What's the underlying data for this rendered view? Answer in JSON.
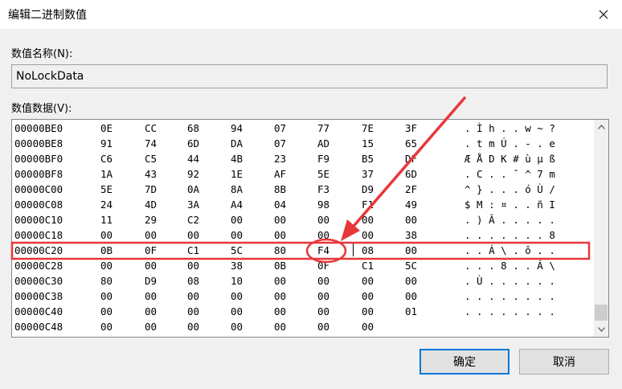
{
  "window": {
    "title": "编辑二进制数值"
  },
  "name_label": "数值名称(N):",
  "name_value": "NoLockData",
  "data_label": "数值数据(V):",
  "rows": [
    {
      "addr": "00000BE0",
      "bytes": [
        "0E",
        "CC",
        "68",
        "94",
        "07",
        "77",
        "7E",
        "3F"
      ],
      "ascii": ". Ì h . . w ~ ?"
    },
    {
      "addr": "00000BE8",
      "bytes": [
        "91",
        "74",
        "6D",
        "DA",
        "07",
        "AD",
        "15",
        "65"
      ],
      "ascii": ". t m Ú . - . e"
    },
    {
      "addr": "00000BF0",
      "bytes": [
        "C6",
        "C5",
        "44",
        "4B",
        "23",
        "F9",
        "B5",
        "DF"
      ],
      "ascii": "Æ Å D K # ù µ ß"
    },
    {
      "addr": "00000BF8",
      "bytes": [
        "1A",
        "43",
        "92",
        "1E",
        "AF",
        "5E",
        "37",
        "6D"
      ],
      "ascii": ". C . . ¯ ^ 7 m"
    },
    {
      "addr": "00000C00",
      "bytes": [
        "5E",
        "7D",
        "0A",
        "8A",
        "8B",
        "F3",
        "D9",
        "2F"
      ],
      "ascii": "^ } . . . ó Ù /"
    },
    {
      "addr": "00000C08",
      "bytes": [
        "24",
        "4D",
        "3A",
        "A4",
        "04",
        "98",
        "F1",
        "49"
      ],
      "ascii": "$ M : ¤ . . ñ I"
    },
    {
      "addr": "00000C10",
      "bytes": [
        "11",
        "29",
        "C2",
        "00",
        "00",
        "00",
        "00",
        "00"
      ],
      "ascii": ". ) Â . . . . ."
    },
    {
      "addr": "00000C18",
      "bytes": [
        "00",
        "00",
        "00",
        "00",
        "00",
        "00",
        "00",
        "38"
      ],
      "ascii": ". . . . . . . 8"
    },
    {
      "addr": "00000C20",
      "bytes": [
        "0B",
        "0F",
        "C1",
        "5C",
        "80",
        "F4",
        "08",
        "00"
      ],
      "ascii": ". . Á \\ . ô . ."
    },
    {
      "addr": "00000C28",
      "bytes": [
        "00",
        "00",
        "00",
        "38",
        "0B",
        "0F",
        "C1",
        "5C"
      ],
      "ascii": ". . . 8 . . Á \\"
    },
    {
      "addr": "00000C30",
      "bytes": [
        "80",
        "D9",
        "08",
        "10",
        "00",
        "00",
        "00",
        "00"
      ],
      "ascii": ". Ù . . . . . ."
    },
    {
      "addr": "00000C38",
      "bytes": [
        "00",
        "00",
        "00",
        "00",
        "00",
        "00",
        "00",
        "00"
      ],
      "ascii": ". . . . . . . ."
    },
    {
      "addr": "00000C40",
      "bytes": [
        "00",
        "00",
        "00",
        "00",
        "00",
        "00",
        "00",
        "01"
      ],
      "ascii": ". . . . . . . ."
    },
    {
      "addr": "00000C48",
      "bytes": [
        "00",
        "00",
        "00",
        "00",
        "00",
        "00",
        "00"
      ],
      "ascii": ""
    }
  ],
  "buttons": {
    "ok": "确定",
    "cancel": "取消"
  },
  "colors": {
    "annotation": "#e8373a",
    "button_default_border": "#0078d7"
  }
}
